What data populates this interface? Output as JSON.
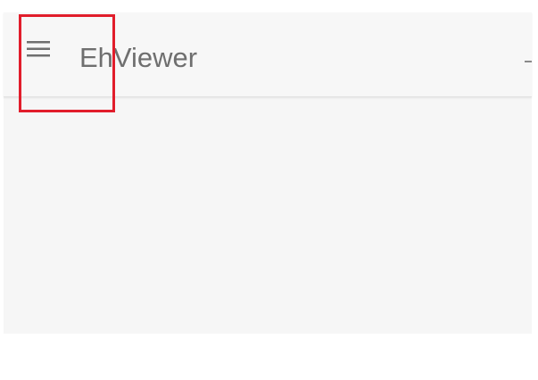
{
  "toolbar": {
    "title": "EhViewer",
    "menu_icon": "hamburger-menu-icon",
    "overflow_icon": "more-icon"
  },
  "colors": {
    "toolbar_bg": "#f7f7f7",
    "content_bg": "#f6f6f6",
    "title_text": "#6f6f6f",
    "highlight": "#e11d2b"
  }
}
